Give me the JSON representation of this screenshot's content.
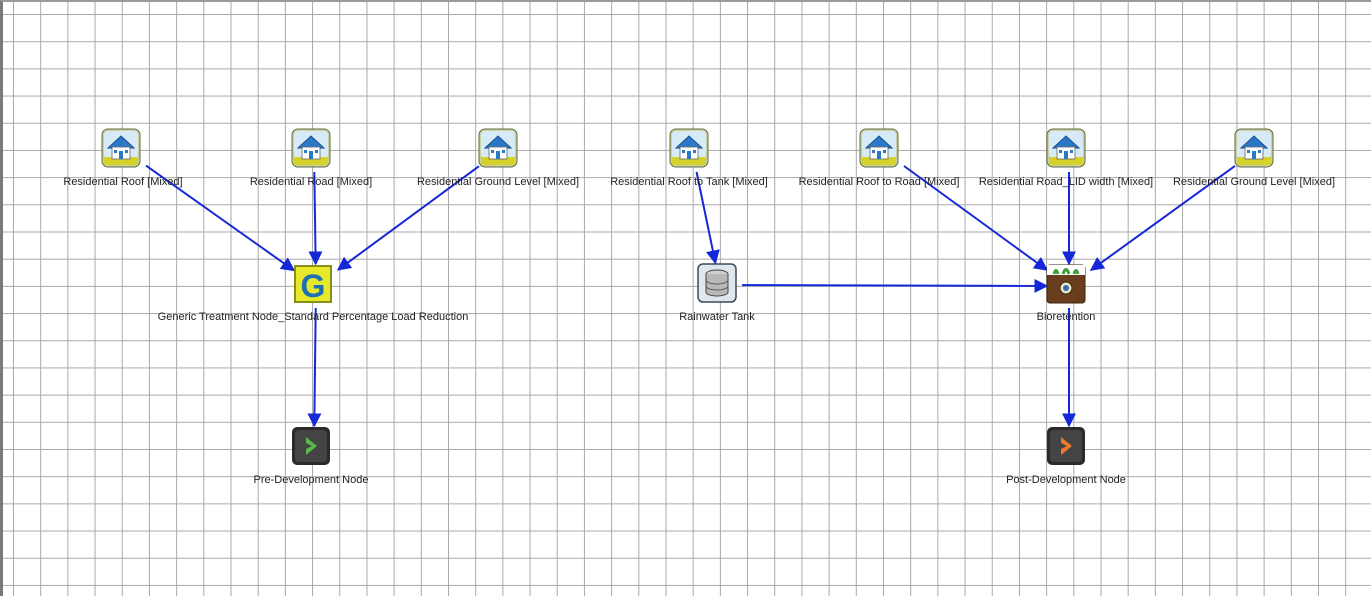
{
  "nodes": {
    "n1": {
      "label": "Residential Roof [Mixed]",
      "kind": "urban-source"
    },
    "n2": {
      "label": "Residential Road [Mixed]",
      "kind": "urban-source"
    },
    "n3": {
      "label": "Residential Ground Level [Mixed]",
      "kind": "urban-source"
    },
    "n4": {
      "label": "Residential Roof to Tank [Mixed]",
      "kind": "urban-source"
    },
    "n5": {
      "label": "Residential Roof to Road [Mixed]",
      "kind": "urban-source"
    },
    "n6": {
      "label": "Residential Road_LID width [Mixed]",
      "kind": "urban-source"
    },
    "n7": {
      "label": "Residential Ground Level [Mixed]",
      "kind": "urban-source"
    },
    "gt": {
      "label": "Generic Treatment Node_Standard Percentage Load Reduction",
      "kind": "generic-treatment",
      "letter": "G"
    },
    "rt": {
      "label": "Rainwater Tank",
      "kind": "rainwater-tank"
    },
    "bio": {
      "label": "Bioretention",
      "kind": "bioretention"
    },
    "pre": {
      "label": "Pre-Development Node",
      "kind": "receiving-node"
    },
    "post": {
      "label": "Post-Development Node",
      "kind": "receiving-node"
    }
  },
  "links": [
    {
      "from": "n1",
      "to": "gt"
    },
    {
      "from": "n2",
      "to": "gt"
    },
    {
      "from": "n3",
      "to": "gt"
    },
    {
      "from": "gt",
      "to": "pre"
    },
    {
      "from": "n4",
      "to": "rt"
    },
    {
      "from": "rt",
      "to": "bio"
    },
    {
      "from": "n5",
      "to": "bio"
    },
    {
      "from": "n6",
      "to": "bio"
    },
    {
      "from": "n7",
      "to": "bio"
    },
    {
      "from": "bio",
      "to": "post"
    }
  ],
  "colors": {
    "link": "#1428d8",
    "grid": "#a9a9a9"
  }
}
